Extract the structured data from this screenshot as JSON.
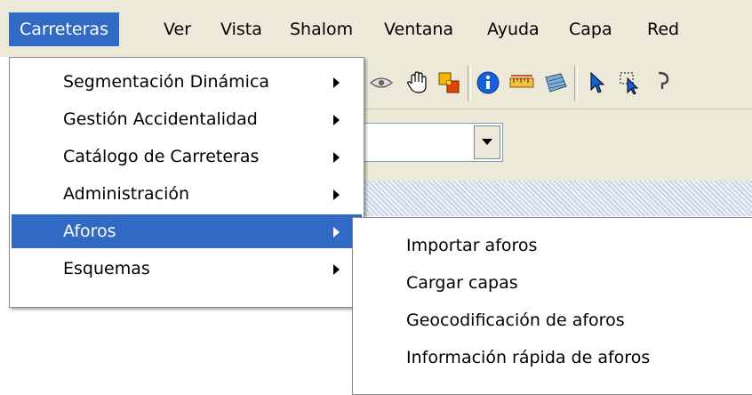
{
  "menubar": {
    "items": [
      "Carreteras",
      "Ver",
      "Vista",
      "Shalom",
      "Ventana",
      "Ayuda",
      "Capa",
      "Red"
    ]
  },
  "menu": {
    "items": [
      {
        "label": "Segmentación Dinámica"
      },
      {
        "label": "Gestión Accidentalidad"
      },
      {
        "label": "Catálogo de Carreteras"
      },
      {
        "label": "Administración"
      },
      {
        "label": "Aforos"
      },
      {
        "label": "Esquemas"
      }
    ]
  },
  "submenu": {
    "items": [
      {
        "label": "Importar aforos"
      },
      {
        "label": "Cargar capas"
      },
      {
        "label": "Geocodificación de aforos"
      },
      {
        "label": "Información rápida de aforos"
      }
    ]
  },
  "colors": {
    "highlight": "#316ac5",
    "menubar_bg": "#ece9d8"
  },
  "toolbar_icons": [
    "eye-icon",
    "hand-pan-icon",
    "layers-icon",
    "info-icon",
    "measure-icon",
    "grid-icon",
    "select-arrow-icon",
    "select-area-icon"
  ]
}
